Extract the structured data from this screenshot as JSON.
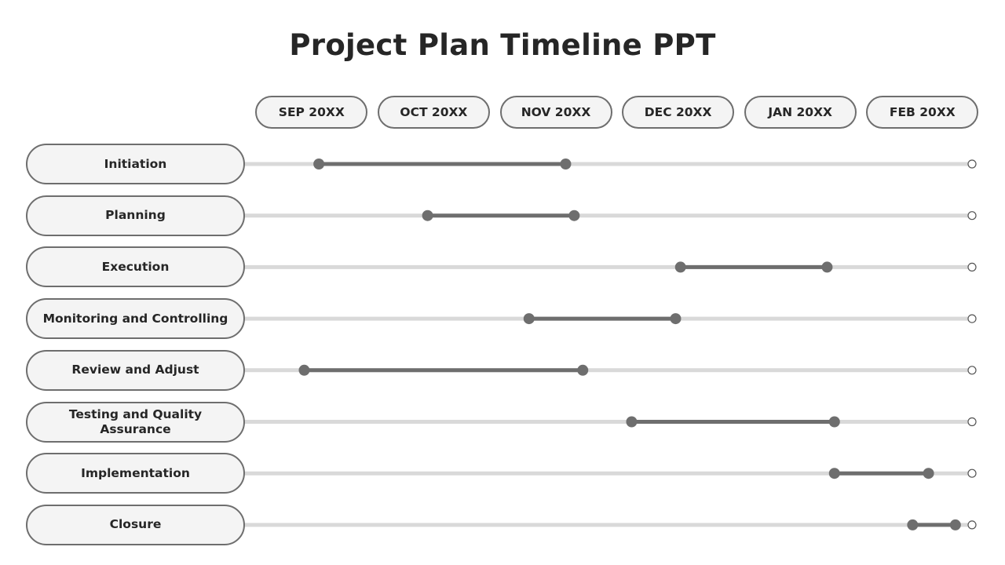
{
  "title": "Project Plan Timeline PPT",
  "colors": {
    "track": "#d9d9d9",
    "bar": "#6e6e6e",
    "endpoint": "#6e6e6e",
    "end_marker_fill": "#ffffff",
    "end_marker_stroke": "#555555",
    "pill_border": "#6e6e6e",
    "pill_fill": "#f4f4f4",
    "text": "#262626"
  },
  "chart_data": {
    "type": "gantt",
    "title": "Project Plan Timeline PPT",
    "xlabel": "",
    "ylabel": "",
    "x_unit": "months from start of SEP 20XX",
    "x_range": [
      0,
      6
    ],
    "months": [
      "SEP 20XX",
      "OCT 20XX",
      "NOV 20XX",
      "DEC 20XX",
      "JAN 20XX",
      "FEB 20XX"
    ],
    "tasks": [
      {
        "name": "Initiation",
        "start": 0.56,
        "end": 2.58
      },
      {
        "name": "Planning",
        "start": 1.45,
        "end": 2.65
      },
      {
        "name": "Execution",
        "start": 3.52,
        "end": 4.72
      },
      {
        "name": "Monitoring and Controlling",
        "start": 2.28,
        "end": 3.48
      },
      {
        "name": "Review and Adjust",
        "start": 0.44,
        "end": 2.72
      },
      {
        "name": "Testing and Quality Assurance",
        "start": 3.12,
        "end": 4.78
      },
      {
        "name": "Implementation",
        "start": 4.78,
        "end": 5.55
      },
      {
        "name": "Closure",
        "start": 5.42,
        "end": 5.77
      }
    ],
    "grid": false,
    "legend": "none"
  }
}
